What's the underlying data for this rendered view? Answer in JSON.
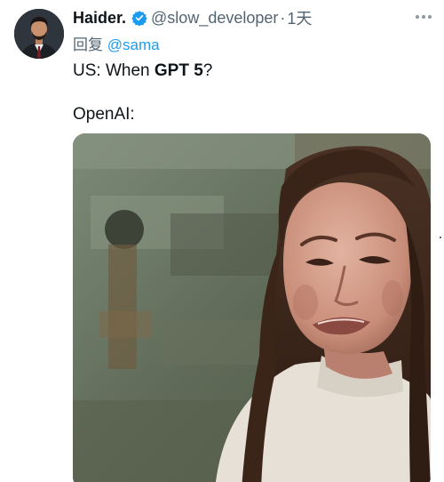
{
  "tweet": {
    "author": {
      "display_name": "Haider.",
      "handle": "@slow_developer",
      "verified": true,
      "verified_icon": "verified-badge-icon",
      "accent": "#1d9bf0"
    },
    "separator": "·",
    "time": "1天",
    "reply": {
      "prefix": "回复",
      "mention": "@sama"
    },
    "text": {
      "line1_prefix": "US: When ",
      "line1_bold": "GPT 5",
      "line1_suffix": "?",
      "line2": "OpenAI:"
    },
    "more_icon": "more-horizontal-icon",
    "media": {
      "type": "image",
      "subject": "crying-woman-meme"
    }
  }
}
